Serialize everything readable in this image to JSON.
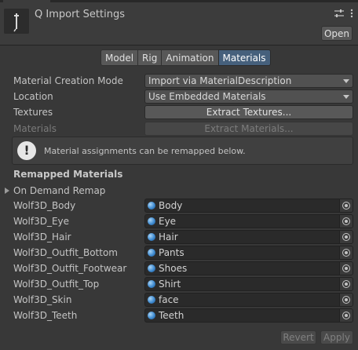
{
  "header": {
    "title": "Q Import Settings",
    "open_label": "Open",
    "icons": [
      "asset-icon",
      "sliders-icon",
      "kebab-menu-icon"
    ]
  },
  "tabs": [
    {
      "label": "Model",
      "active": false
    },
    {
      "label": "Rig",
      "active": false
    },
    {
      "label": "Animation",
      "active": false
    },
    {
      "label": "Materials",
      "active": true
    }
  ],
  "settings": {
    "creation_mode_label": "Material Creation Mode",
    "creation_mode_value": "Import via MaterialDescription",
    "location_label": "Location",
    "location_value": "Use Embedded Materials",
    "textures_label": "Textures",
    "extract_textures": "Extract Textures...",
    "materials_label": "Materials",
    "extract_materials": "Extract Materials..."
  },
  "help": {
    "text": "Material assignments can be remapped below.",
    "icon": "warning-icon"
  },
  "remapped": {
    "title": "Remapped Materials",
    "on_demand": "On Demand Remap",
    "items": [
      {
        "name": "Wolf3D_Body",
        "value": "Body"
      },
      {
        "name": "Wolf3D_Eye",
        "value": "Eye"
      },
      {
        "name": "Wolf3D_Hair",
        "value": "Hair"
      },
      {
        "name": "Wolf3D_Outfit_Bottom",
        "value": "Pants"
      },
      {
        "name": "Wolf3D_Outfit_Footwear",
        "value": "Shoes"
      },
      {
        "name": "Wolf3D_Outfit_Top",
        "value": "Shirt"
      },
      {
        "name": "Wolf3D_Skin",
        "value": "face"
      },
      {
        "name": "Wolf3D_Teeth",
        "value": "Teeth"
      }
    ]
  },
  "footer": {
    "revert": "Revert",
    "apply": "Apply"
  },
  "colors": {
    "background": "#383838",
    "active_tab": "#46607c",
    "material_sphere": "#3e8ad0"
  }
}
